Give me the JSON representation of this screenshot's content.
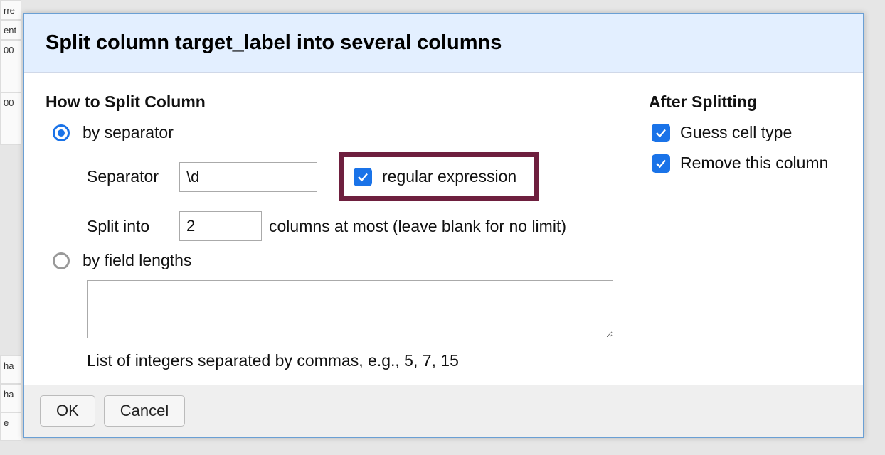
{
  "dialog": {
    "title": "Split column target_label into several columns",
    "left": {
      "heading": "How to Split Column",
      "radio_separator_label": "by separator",
      "separator_label": "Separator",
      "separator_value": "\\d",
      "regex_label": "regular expression",
      "splitinto_label": "Split into",
      "splitinto_value": "2",
      "splitinto_suffix": "columns at most (leave blank for no limit)",
      "radio_fieldlen_label": "by field lengths",
      "fieldlen_value": "",
      "fieldlen_hint": "List of integers separated by commas, e.g., 5, 7, 15"
    },
    "right": {
      "heading": "After Splitting",
      "guess_label": "Guess cell type",
      "remove_label": "Remove this column"
    },
    "footer": {
      "ok": "OK",
      "cancel": "Cancel"
    }
  },
  "background": {
    "c0": "rre",
    "c1": "ent",
    "c2": "00",
    "c3": "00",
    "c4": "ha",
    "c5": "ha",
    "c6": "e"
  }
}
